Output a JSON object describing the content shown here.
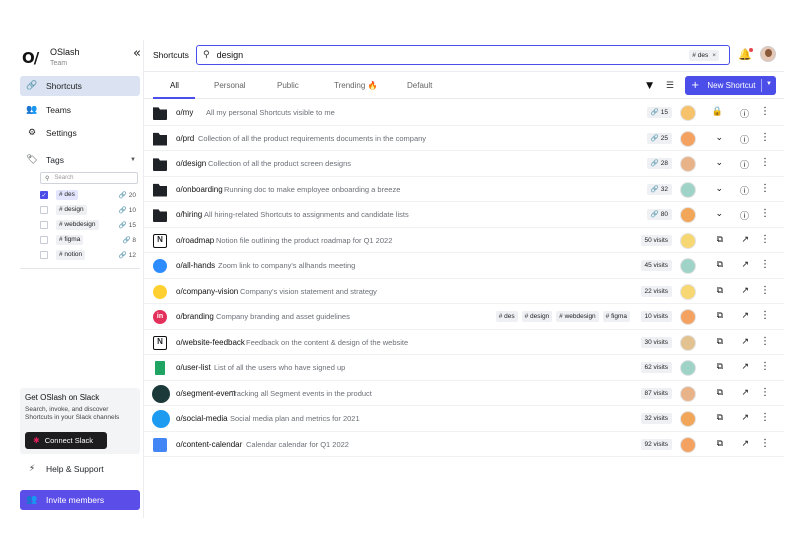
{
  "brand": {
    "name": "OSlash",
    "team": "Team",
    "logo": "O/"
  },
  "sidebar": {
    "items": [
      {
        "label": "Shortcuts",
        "icon": "link-icon"
      },
      {
        "label": "Teams",
        "icon": "people-icon"
      },
      {
        "label": "Settings",
        "icon": "gear-icon"
      }
    ],
    "tags_label": "Tags",
    "tag_search_placeholder": "Search",
    "tags": [
      {
        "label": "# des",
        "count": "20",
        "checked": true
      },
      {
        "label": "# design",
        "count": "10",
        "checked": false
      },
      {
        "label": "# webdesign",
        "count": "15",
        "checked": false
      },
      {
        "label": "# figma",
        "count": "8",
        "checked": false
      },
      {
        "label": "# notion",
        "count": "12",
        "checked": false
      }
    ],
    "promo": {
      "title": "Get OSlash on Slack",
      "desc": "Search, invoke, and discover Shortcuts in your Slack channels",
      "button": "Connect Slack"
    },
    "help": "Help & Support",
    "invite": "Invite members"
  },
  "topbar": {
    "crumb": "Shortcuts",
    "search_value": "design",
    "search_chip": "# des",
    "search_chip_close": "×"
  },
  "tabs": {
    "items": [
      "All",
      "Personal",
      "Public",
      "Trending 🔥",
      "Default"
    ],
    "new_button": "New Shortcut"
  },
  "accent": "#4b4ee8",
  "rows": [
    {
      "name": "o/my",
      "desc": "All my personal Shortcuts visible to me",
      "meta": "🔗 15",
      "icon": "folder",
      "a1": "🔒",
      "a2": "ⓘ",
      "tags": []
    },
    {
      "name": "o/prd",
      "desc": "Collection of all the product requirements documents in the company",
      "meta": "🔗 25",
      "icon": "folder",
      "a1": "⌄",
      "a2": "ⓘ",
      "tags": []
    },
    {
      "name": "o/design",
      "desc": "Collection of all the product screen designs",
      "meta": "🔗 28",
      "icon": "folder",
      "a1": "⌄",
      "a2": "ⓘ",
      "tags": []
    },
    {
      "name": "o/onboarding",
      "desc": "Running doc to make employee onboarding a breeze",
      "meta": "🔗 32",
      "icon": "folder",
      "a1": "⌄",
      "a2": "ⓘ",
      "tags": []
    },
    {
      "name": "o/hiring",
      "desc": "All hiring-related Shortcuts to assignments and candidate lists",
      "meta": "🔗 80",
      "icon": "folder",
      "a1": "⌄",
      "a2": "ⓘ",
      "tags": []
    },
    {
      "name": "o/roadmap",
      "desc": "Notion file outlining the product roadmap for Q1 2022",
      "meta": "50 visits",
      "icon": "notion",
      "a1": "⧉",
      "a2": "↗",
      "tags": []
    },
    {
      "name": "o/all-hands",
      "desc": "Zoom link to company's allhands meeting",
      "meta": "45 visits",
      "icon": "zoom",
      "a1": "⧉",
      "a2": "↗",
      "tags": []
    },
    {
      "name": "o/company-vision",
      "desc": "Company's vision statement and strategy",
      "meta": "22 visits",
      "icon": "miro",
      "a1": "⧉",
      "a2": "↗",
      "tags": []
    },
    {
      "name": "o/branding",
      "desc": "Company branding and asset guidelines",
      "meta": "10 visits",
      "icon": "invision",
      "a1": "⧉",
      "a2": "↗",
      "tags": [
        "# des",
        "# design",
        "# webdesign",
        "# figma"
      ]
    },
    {
      "name": "o/website-feedback",
      "desc": "Feedback on the content & design of the website",
      "meta": "30 visits",
      "icon": "notion",
      "a1": "⧉",
      "a2": "↗",
      "tags": []
    },
    {
      "name": "o/user-list",
      "desc": "List of all the users who have signed up",
      "meta": "62 visits",
      "icon": "sheets",
      "a1": "⧉",
      "a2": "↗",
      "tags": []
    },
    {
      "name": "o/segment-event",
      "desc": "Tracking all Segment events in the product",
      "meta": "87 visits",
      "icon": "segment",
      "a1": "⧉",
      "a2": "↗",
      "tags": []
    },
    {
      "name": "o/social-media",
      "desc": "Social media plan and metrics for 2021",
      "meta": "32 visits",
      "icon": "twitter",
      "a1": "⧉",
      "a2": "↗",
      "tags": []
    },
    {
      "name": "o/content-calendar",
      "desc": "Calendar calendar for Q1 2022",
      "meta": "92 visits",
      "icon": "gcal",
      "a1": "⧉",
      "a2": "↗",
      "tags": []
    }
  ]
}
